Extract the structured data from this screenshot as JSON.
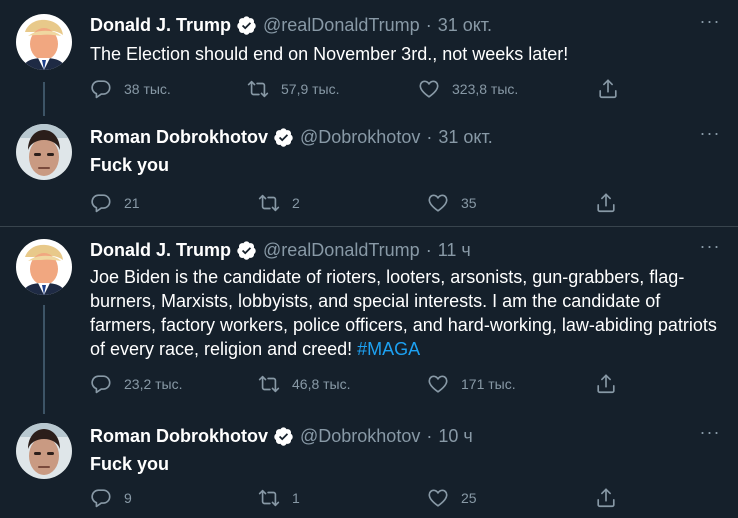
{
  "tweets": [
    {
      "name": "Donald J. Trump",
      "handle": "@realDonaldTrump",
      "dot": "·",
      "time": "31 окт.",
      "text": "The Election should end on November 3rd., not weeks later!",
      "reply_count": "38 тыс.",
      "retweet_count": "57,9 тыс.",
      "like_count": "323,8 тыс."
    },
    {
      "name": "Roman Dobrokhotov",
      "handle": "@Dobrokhotov",
      "dot": "·",
      "time": "31 окт.",
      "text": "Fuck you",
      "reply_count": "21",
      "retweet_count": "2",
      "like_count": "35"
    },
    {
      "name": "Donald J. Trump",
      "handle": "@realDonaldTrump",
      "dot": "·",
      "time": "11 ч",
      "text": "Joe Biden is the candidate of rioters, looters, arsonists, gun-grabbers, flag-burners, Marxists, lobbyists, and special interests. I am the candidate of farmers, factory workers, police officers, and hard-working, law-abiding patriots of every race, religion and creed!",
      "hashtag": "#MAGA",
      "reply_count": "23,2 тыс.",
      "retweet_count": "46,8 тыс.",
      "like_count": "171 тыс."
    },
    {
      "name": "Roman Dobrokhotov",
      "handle": "@Dobrokhotov",
      "dot": "·",
      "time": "10 ч",
      "text": "Fuck you",
      "reply_count": "9",
      "retweet_count": "1",
      "like_count": "25"
    }
  ],
  "icons": {
    "more": "more-icon",
    "reply": "reply-icon",
    "retweet": "retweet-icon",
    "like": "like-icon",
    "share": "share-icon",
    "verified": "verified-badge-icon"
  },
  "colors": {
    "background": "#15202b",
    "secondary_text": "#8899a6",
    "hashtag": "#1da1f2",
    "divider": "#38444d"
  }
}
